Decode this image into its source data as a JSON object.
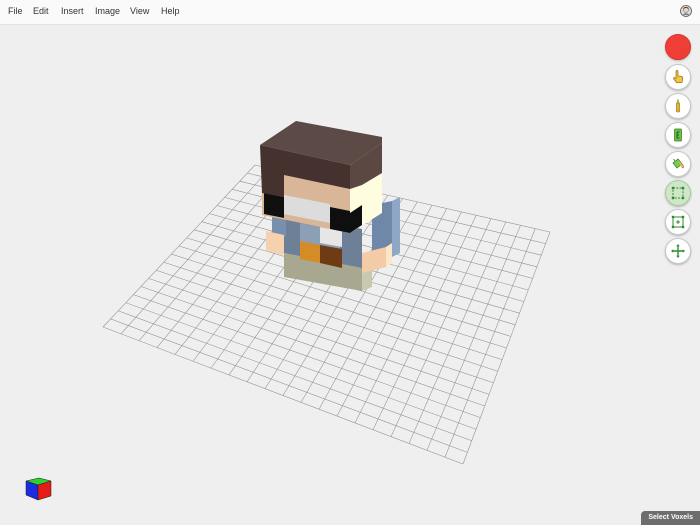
{
  "menu": {
    "items": [
      "File",
      "Edit",
      "Insert",
      "Image",
      "View",
      "Help"
    ]
  },
  "toolbar": {
    "active_color": "#ef3e36",
    "tools": [
      {
        "name": "color-swatch",
        "icon": "color-dot"
      },
      {
        "name": "paint-tool",
        "icon": "hand-pointer-icon"
      },
      {
        "name": "brush-tool",
        "icon": "brush-icon"
      },
      {
        "name": "eraser-tool",
        "icon": "eraser-icon"
      },
      {
        "name": "fill-tool",
        "icon": "paint-bucket-icon"
      },
      {
        "name": "select-tool",
        "icon": "select-box-icon",
        "active": true
      },
      {
        "name": "move-tool",
        "icon": "select-move-icon"
      },
      {
        "name": "pan-tool",
        "icon": "move-cross-icon"
      }
    ]
  },
  "status": {
    "text": "Select Voxels"
  },
  "colors": {
    "accent_green": "#2e8b2e",
    "hair": "#4a3b37",
    "skin": "#d9b697",
    "shirt": "#6b7f9a",
    "pants": "#a5a58e"
  }
}
